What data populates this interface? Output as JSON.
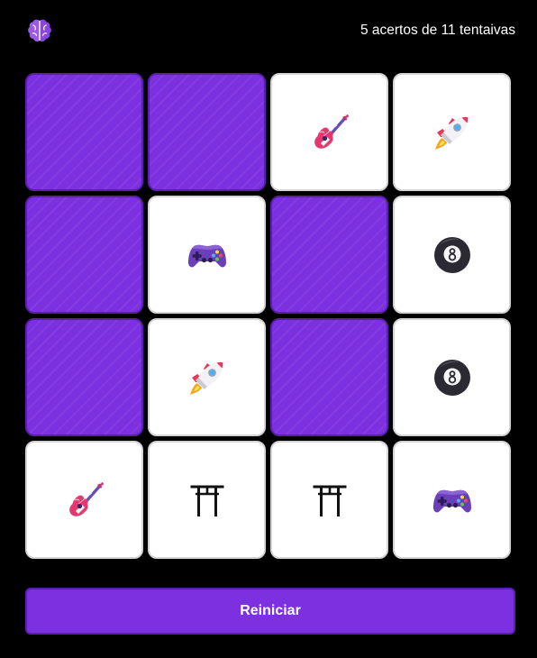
{
  "header": {
    "logo_icon": "brain-icon",
    "score_text": "5 acertos de 11 tentaivas"
  },
  "board": {
    "columns": 4,
    "rows": 4,
    "cards": [
      {
        "state": "hidden",
        "icon": null
      },
      {
        "state": "hidden",
        "icon": null
      },
      {
        "state": "revealed",
        "icon": "guitar-icon"
      },
      {
        "state": "revealed",
        "icon": "rocket-icon"
      },
      {
        "state": "hidden",
        "icon": null
      },
      {
        "state": "revealed",
        "icon": "game-controller-icon"
      },
      {
        "state": "hidden",
        "icon": null
      },
      {
        "state": "revealed",
        "icon": "eight-ball-icon"
      },
      {
        "state": "hidden",
        "icon": null
      },
      {
        "state": "revealed",
        "icon": "rocket-icon"
      },
      {
        "state": "hidden",
        "icon": null
      },
      {
        "state": "revealed",
        "icon": "eight-ball-icon"
      },
      {
        "state": "revealed",
        "icon": "guitar-icon"
      },
      {
        "state": "revealed",
        "icon": "torii-gate-icon"
      },
      {
        "state": "revealed",
        "icon": "torii-gate-icon"
      },
      {
        "state": "revealed",
        "icon": "game-controller-icon"
      }
    ]
  },
  "restart_button": {
    "label": "Reiniciar"
  },
  "colors": {
    "background": "#000000",
    "card_hidden": "#7c30e0",
    "card_hidden_border": "#5b1fb0",
    "card_revealed": "#ffffff",
    "accent": "#7c30e0"
  }
}
